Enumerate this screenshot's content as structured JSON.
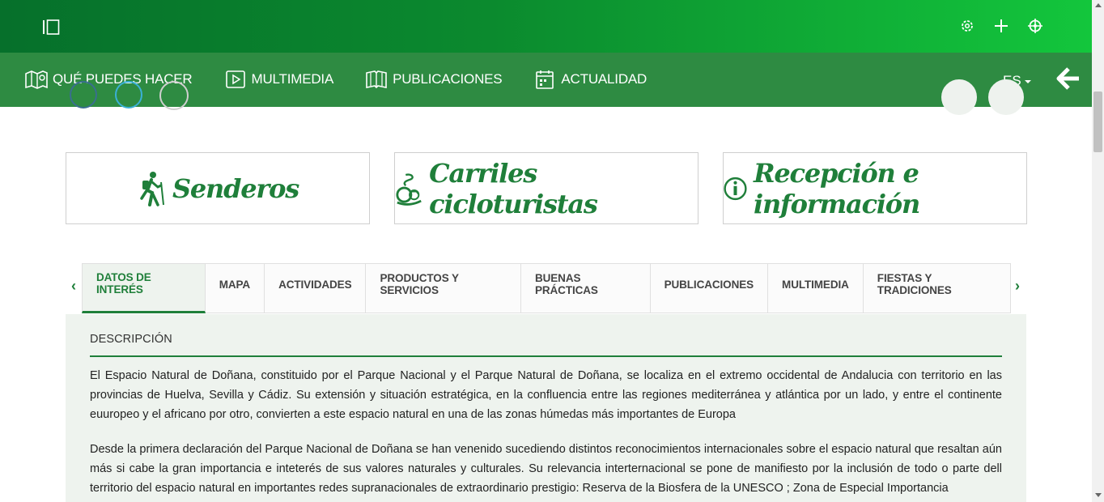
{
  "nav": {
    "items": [
      {
        "label": "QUÉ PUEDES HACER",
        "icon": "map-icon"
      },
      {
        "label": "MULTIMEDIA",
        "icon": "play-icon"
      },
      {
        "label": "PUBLICACIONES",
        "icon": "book-icon"
      },
      {
        "label": "ACTUALIDAD",
        "icon": "calendar-icon"
      }
    ],
    "language": "ES"
  },
  "top_icons": [
    "gear-icon",
    "plus-icon",
    "target-icon"
  ],
  "cards": [
    {
      "label": "Senderos",
      "icon": "hiker-icon"
    },
    {
      "label": "Carriles cicloturistas",
      "icon": "bicycle-icon"
    },
    {
      "label": "Recepción e información",
      "icon": "info-icon"
    }
  ],
  "tabs": [
    {
      "label": "DATOS DE INTERÉS",
      "active": true
    },
    {
      "label": "MAPA",
      "active": false
    },
    {
      "label": "ACTIVIDADES",
      "active": false
    },
    {
      "label": "PRODUCTOS Y SERVICIOS",
      "active": false
    },
    {
      "label": "BUENAS PRÁCTICAS",
      "active": false
    },
    {
      "label": "PUBLICACIONES",
      "active": false
    },
    {
      "label": "MULTIMEDIA",
      "active": false
    },
    {
      "label": "FIESTAS Y TRADICIONES",
      "active": false
    }
  ],
  "description": {
    "heading": "DESCRIPCIÓN",
    "paragraph1": "El Espacio Natural de Doñana, constituido por el Parque Nacional y el Parque Natural de Doñana, se localiza en el extremo occidental de Andalucia con territorio en las provincias de Huelva, Sevilla y Cádiz. Su extensión y situación estratégica, en la confluencia entre las regiones mediterránea y atlántica por un lado, y entre el continente euuropeo y el africano por otro, convierten a este espacio natural en una de las zonas húmedas más importantes de Europa",
    "paragraph2": "Desde la primera declaración del Parque Nacional de Doñana se han venenido sucediendo distintos reconocimientos internacionales sobre el espacio natural que resaltan aún más si cabe la gran importancia e inteterés de sus valores naturales y culturales. Su relevancia interternacional se pone de manifiesto por la inclusión de todo o parte dell territorio del espacio natural en importantes redes supranacionales de extraordinario prestigio: Reserva de la Biosfera de la UNESCO ; Zona de Especial Importancia"
  },
  "colors": {
    "brand_green": "#1f7f3a",
    "nav_green": "#2e8b42",
    "panel_bg": "#eef3ee"
  }
}
